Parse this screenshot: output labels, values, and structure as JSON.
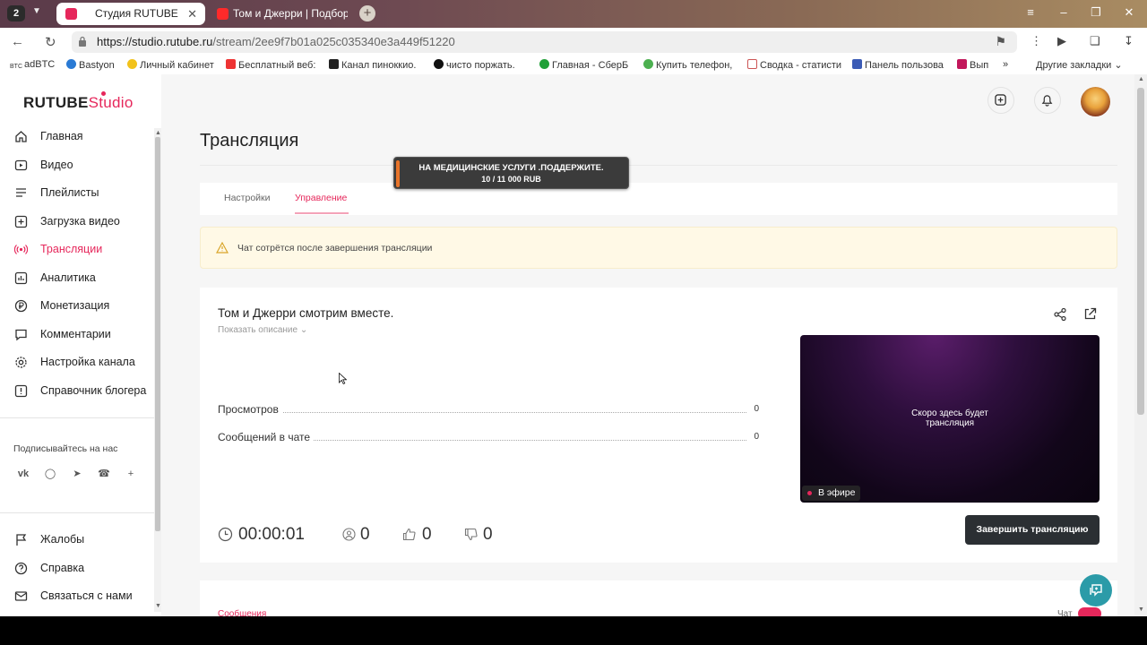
{
  "browser": {
    "tab_count": "2",
    "tabs": [
      {
        "title": "Студия RUTUBE",
        "active": true
      },
      {
        "title": "Том и Джерри | Подборк",
        "active": false
      }
    ],
    "url_host": "https://studio.rutube.ru",
    "url_path": "/stream/2ee9f7b01a025c035340e3a449f51220",
    "bookmarks": [
      "adBTC",
      "Bastyon",
      "Личный кабинет",
      "Бесплатный веб:",
      "Канал пиноккио.",
      "чисто поржать.",
      "Главная - СберБ",
      "Купить телефон,",
      "Сводка - статисти",
      "Панель пользова",
      "Вып"
    ],
    "other_bookmarks": "Другие закладки"
  },
  "app": {
    "logo_main": "RUTUBE",
    "logo_studio": "Studio"
  },
  "sidebar": {
    "items": [
      {
        "label": "Главная",
        "icon": "home-icon"
      },
      {
        "label": "Видео",
        "icon": "video-icon"
      },
      {
        "label": "Плейлисты",
        "icon": "playlist-icon"
      },
      {
        "label": "Загрузка видео",
        "icon": "upload-icon"
      },
      {
        "label": "Трансляции",
        "icon": "broadcast-icon",
        "active": true
      },
      {
        "label": "Аналитика",
        "icon": "analytics-icon"
      },
      {
        "label": "Монетизация",
        "icon": "ruble-icon"
      },
      {
        "label": "Комментарии",
        "icon": "comment-icon"
      },
      {
        "label": "Настройка канала",
        "icon": "gear-icon"
      },
      {
        "label": "Справочник блогера",
        "icon": "info-icon"
      }
    ],
    "follow_title": "Подписывайтесь на нас",
    "socials": [
      "vk-icon",
      "ok-icon",
      "telegram-icon",
      "viber-icon",
      "plus-icon"
    ],
    "bottom_items": [
      {
        "label": "Жалобы",
        "icon": "flag-icon"
      },
      {
        "label": "Справка",
        "icon": "help-icon"
      },
      {
        "label": "Связаться с нами",
        "icon": "mail-icon"
      }
    ]
  },
  "main": {
    "page_title": "Трансляция",
    "donation": {
      "line1": "НА МЕДИЦИНСКИЕ УСЛУГИ .ПОДДЕРЖИТЕ.",
      "line2": "10 / 11 000 RUB"
    },
    "tabs": [
      {
        "label": "Настройки",
        "active": false
      },
      {
        "label": "Управление",
        "active": true
      }
    ],
    "alert_text": "Чат сотрётся после завершения трансляции",
    "stream": {
      "title": "Том и Джерри смотрим вместе.",
      "show_description": "Показать описание",
      "stats": [
        {
          "label": "Просмотров",
          "value": "0"
        },
        {
          "label": "Сообщений в чате",
          "value": "0"
        }
      ],
      "preview_text_1": "Скоро здесь будет",
      "preview_text_2": "трансляция",
      "live_label": "В эфире",
      "duration": "00:00:01",
      "viewers": "0",
      "likes": "0",
      "dislikes": "0",
      "end_button": "Завершить трансляцию"
    },
    "chat_section": {
      "left_label": "Сообщения",
      "right_label": "Чат"
    }
  },
  "colors": {
    "accent": "#e6275b",
    "button_dark": "#2b2f33",
    "alert_bg": "#fff9e6",
    "fab": "#2b9ba8"
  }
}
